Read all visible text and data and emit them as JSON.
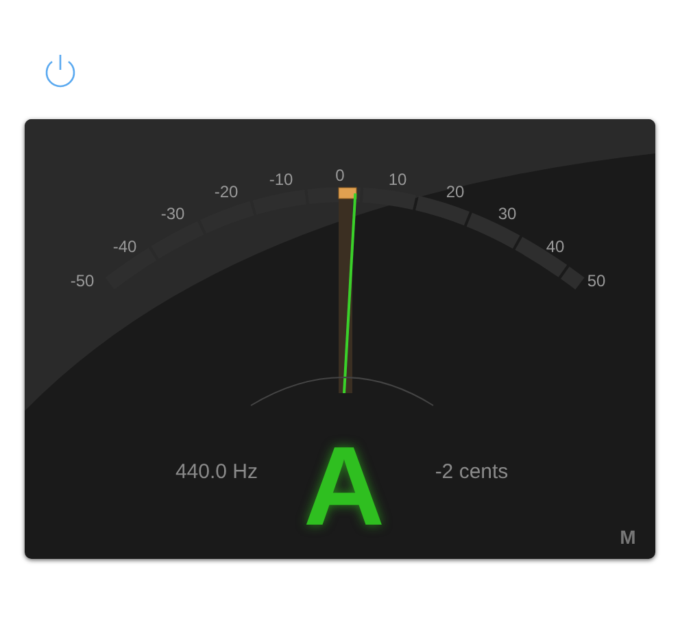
{
  "power_button": {
    "on": true
  },
  "tuner": {
    "scale_labels": [
      "-50",
      "-40",
      "-30",
      "-20",
      "-10",
      "0",
      "10",
      "20",
      "30",
      "40",
      "50"
    ],
    "note": "A",
    "frequency": "440.0 Hz",
    "deviation": "-2 cents",
    "mode": "M"
  }
}
